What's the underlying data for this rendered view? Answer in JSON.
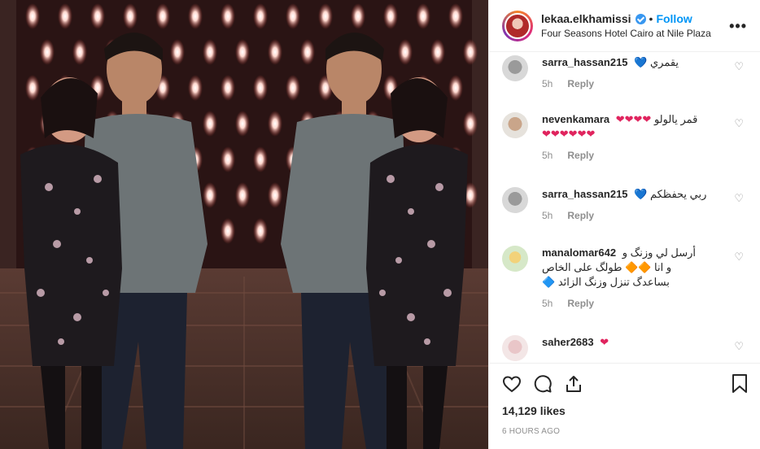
{
  "post": {
    "username": "lekaa.elkhamissi",
    "separator": "•",
    "follow_label": "Follow",
    "location": "Four Seasons Hotel Cairo at Nile Plaza",
    "more_label": "•••"
  },
  "comments": [
    {
      "user": "sarra_hassan215",
      "lines": [
        "يقمري"
      ],
      "emoji": [
        "💙"
      ],
      "time": "5h",
      "reply": "Reply"
    },
    {
      "user": "nevenkamara",
      "lines": [
        "قمر يالولو"
      ],
      "emoji": [
        "❤❤❤❤",
        "❤❤❤❤❤❤"
      ],
      "time": "5h",
      "reply": "Reply"
    },
    {
      "user": "sarra_hassan215",
      "lines": [
        "ربي يحفظكم"
      ],
      "emoji": [
        "💙"
      ],
      "time": "5h",
      "reply": "Reply"
    },
    {
      "user": "manalomar642",
      "lines": [
        "أرسل لي وزنگ و",
        "طولگ على الخاص",
        "و انا",
        "بساعدگ تنزل وزنگ الزائد"
      ],
      "emoji": [
        "🔶🔶",
        "🔷"
      ],
      "time": "5h",
      "reply": "Reply"
    },
    {
      "user": "saher2683",
      "lines": [
        ""
      ],
      "emoji": [
        "❤"
      ],
      "time": "",
      "reply": ""
    }
  ],
  "likes_text": "14,129 likes",
  "time_ago": "6 HOURS AGO",
  "colors": {
    "accent": "#0095f6",
    "verified": "#3897f0",
    "heart": "#e0245e",
    "muted": "#8e8e8e"
  }
}
